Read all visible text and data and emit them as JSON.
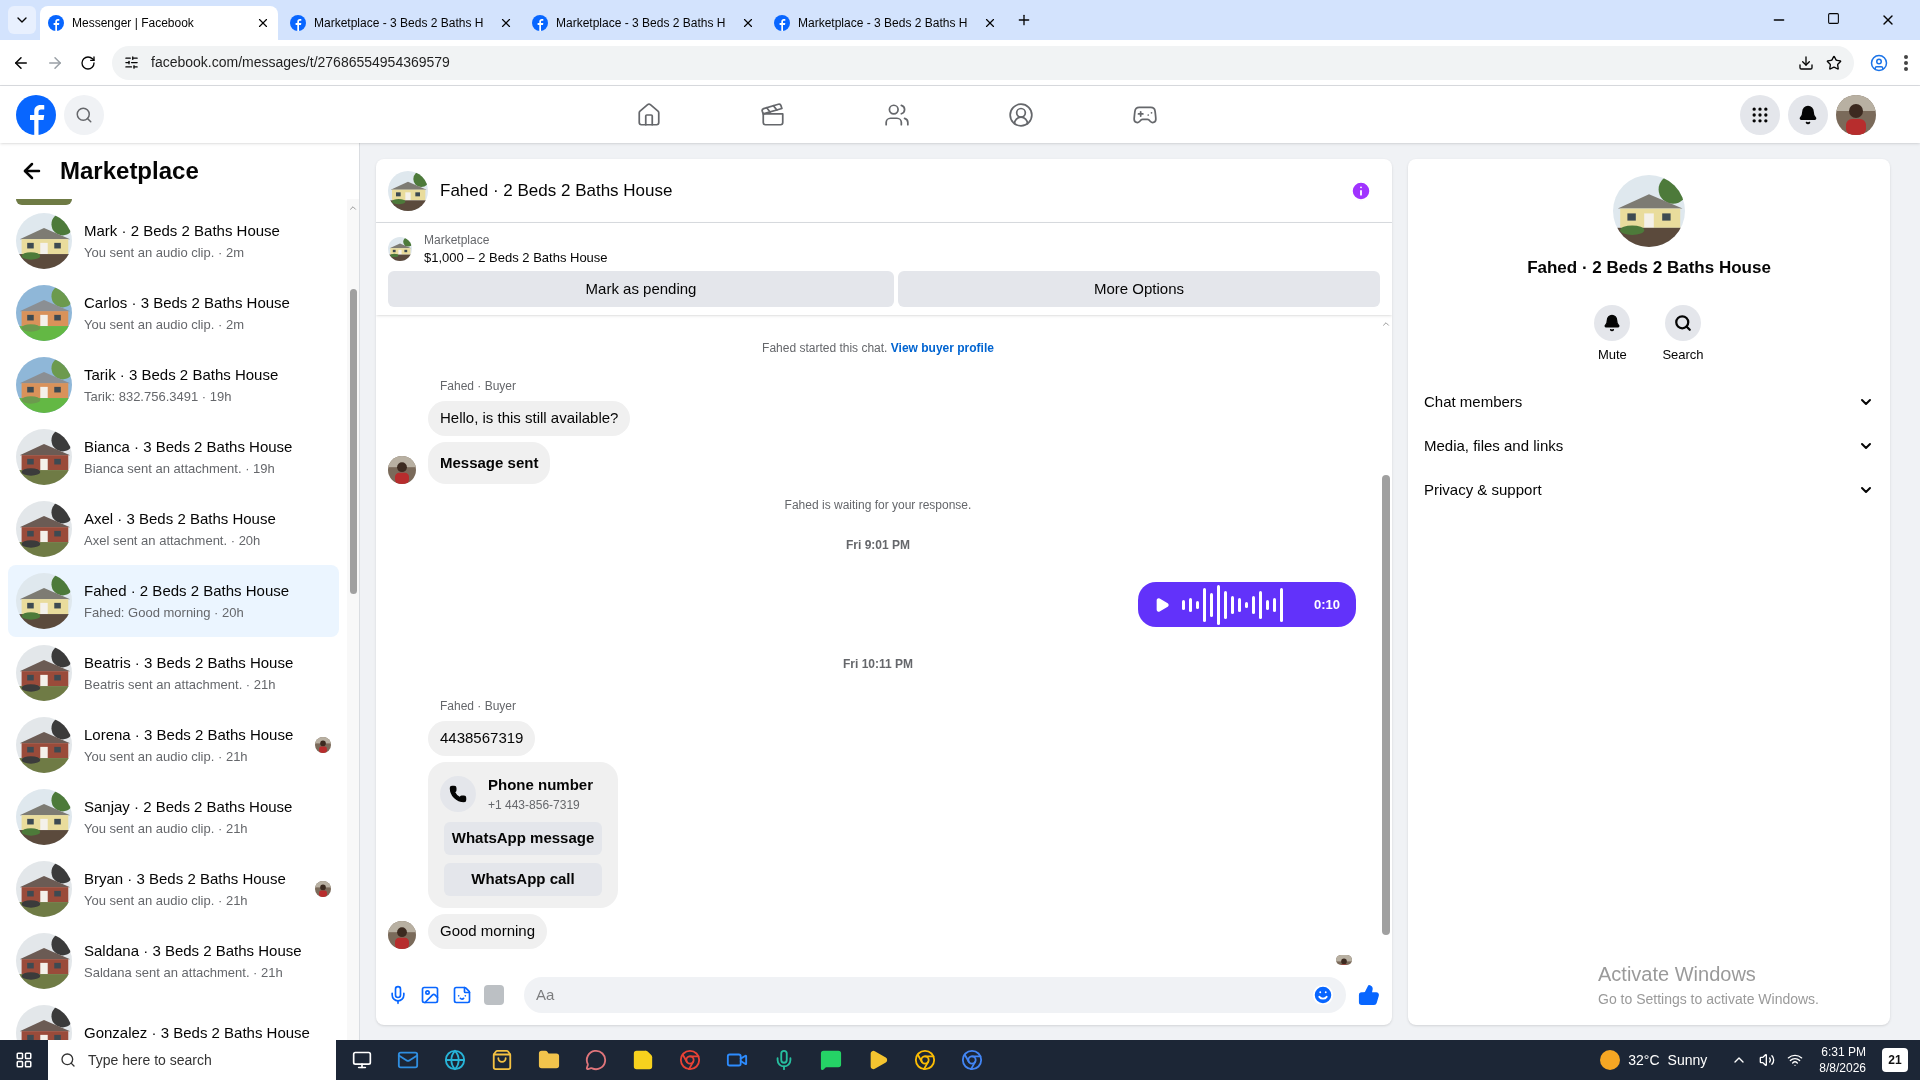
{
  "browser": {
    "tabs": [
      {
        "title": "Messenger | Facebook",
        "selected": true
      },
      {
        "title": "Marketplace - 3 Beds 2 Baths H",
        "selected": false
      },
      {
        "title": "Marketplace - 3 Beds 2 Baths H",
        "selected": false
      },
      {
        "title": "Marketplace - 3 Beds 2 Baths H",
        "selected": false
      }
    ],
    "url": "facebook.com/messages/t/27686554954369579"
  },
  "sidebar": {
    "title": "Marketplace",
    "conversations": [
      {
        "title": "Mark · 2 Beds 2 Baths House",
        "preview": "You sent an audio clip. · 2m",
        "selected": false,
        "seen": false
      },
      {
        "title": "Carlos · 3 Beds 2 Baths House",
        "preview": "You sent an audio clip. · 2m",
        "selected": false,
        "seen": false
      },
      {
        "title": "Tarik · 3 Beds 2 Baths House",
        "preview": "Tarik: 832.756.3491 · 19h",
        "selected": false,
        "seen": false
      },
      {
        "title": "Bianca · 3 Beds 2 Baths House",
        "preview": "Bianca sent an attachment. · 19h",
        "selected": false,
        "seen": false
      },
      {
        "title": "Axel · 3 Beds 2 Baths House",
        "preview": "Axel sent an attachment. · 20h",
        "selected": false,
        "seen": false
      },
      {
        "title": "Fahed · 2 Beds 2 Baths House",
        "preview": "Fahed: Good morning · 20h",
        "selected": true,
        "seen": false
      },
      {
        "title": "Beatris · 3 Beds 2 Baths House",
        "preview": "Beatris sent an attachment. · 21h",
        "selected": false,
        "seen": false
      },
      {
        "title": "Lorena · 3 Beds 2 Baths House",
        "preview": "You sent an audio clip. · 21h",
        "selected": false,
        "seen": true
      },
      {
        "title": "Sanjay · 2 Beds 2 Baths House",
        "preview": "You sent an audio clip. · 21h",
        "selected": false,
        "seen": false
      },
      {
        "title": "Bryan · 3 Beds 2 Baths House",
        "preview": "You sent an audio clip. · 21h",
        "selected": false,
        "seen": true
      },
      {
        "title": "Saldana · 3 Beds 2 Baths House",
        "preview": "Saldana sent an attachment. · 21h",
        "selected": false,
        "seen": false
      },
      {
        "title": "Gonzalez · 3 Beds 2 Baths House",
        "selected": false,
        "seen": false
      }
    ]
  },
  "chat": {
    "title": "Fahed · 2 Beds 2 Baths House",
    "listing": {
      "label": "Marketplace",
      "title": "$1,000 – 2 Beds 2 Baths House"
    },
    "actions": [
      "Mark as pending",
      "More Options"
    ],
    "messages": [
      {
        "kind": "system",
        "text": "Fahed started this chat.",
        "link": "View buyer profile"
      },
      {
        "kind": "sender",
        "text": "Fahed · Buyer"
      },
      {
        "kind": "incoming",
        "text": "Hello, is this still available?",
        "avatar": false,
        "emphasis": false
      },
      {
        "kind": "incoming",
        "text": "Message sent",
        "avatar": true,
        "emphasis": true
      },
      {
        "kind": "system",
        "text": "Fahed is waiting for your response."
      },
      {
        "kind": "time",
        "text": "Fri 9:01 PM"
      },
      {
        "kind": "audio",
        "duration": "0:10"
      },
      {
        "kind": "time",
        "text": "Fri 10:11 PM"
      },
      {
        "kind": "sender",
        "text": "Fahed · Buyer"
      },
      {
        "kind": "incoming",
        "text": "4438567319",
        "avatar": false,
        "emphasis": false
      },
      {
        "kind": "contact",
        "title": "Phone number",
        "phone": "+1 443-856-7319",
        "actions": [
          "WhatsApp message",
          "WhatsApp call"
        ]
      },
      {
        "kind": "incoming",
        "text": "Good morning",
        "avatar": true,
        "emphasis": false
      },
      {
        "kind": "receipt"
      }
    ],
    "composer": {
      "placeholder": "Aa"
    }
  },
  "details": {
    "title": "Fahed · 2 Beds 2 Baths House",
    "actions": [
      {
        "kind": "mute",
        "label": "Mute"
      },
      {
        "kind": "search",
        "label": "Search"
      }
    ],
    "sections": [
      {
        "label": "Chat members",
        "expanded": false
      },
      {
        "label": "Media, files and links",
        "expanded": false
      },
      {
        "label": "Privacy & support",
        "expanded": false
      }
    ]
  },
  "watermark": {
    "title": "Activate Windows",
    "subtitle": "Go to Settings to activate Windows."
  },
  "taskbar": {
    "search_placeholder": "Type here to search",
    "temperature": "32°C",
    "weather": "Sunny",
    "time": "6:31 PM",
    "date": "8/8/2026",
    "notifications": "21"
  }
}
